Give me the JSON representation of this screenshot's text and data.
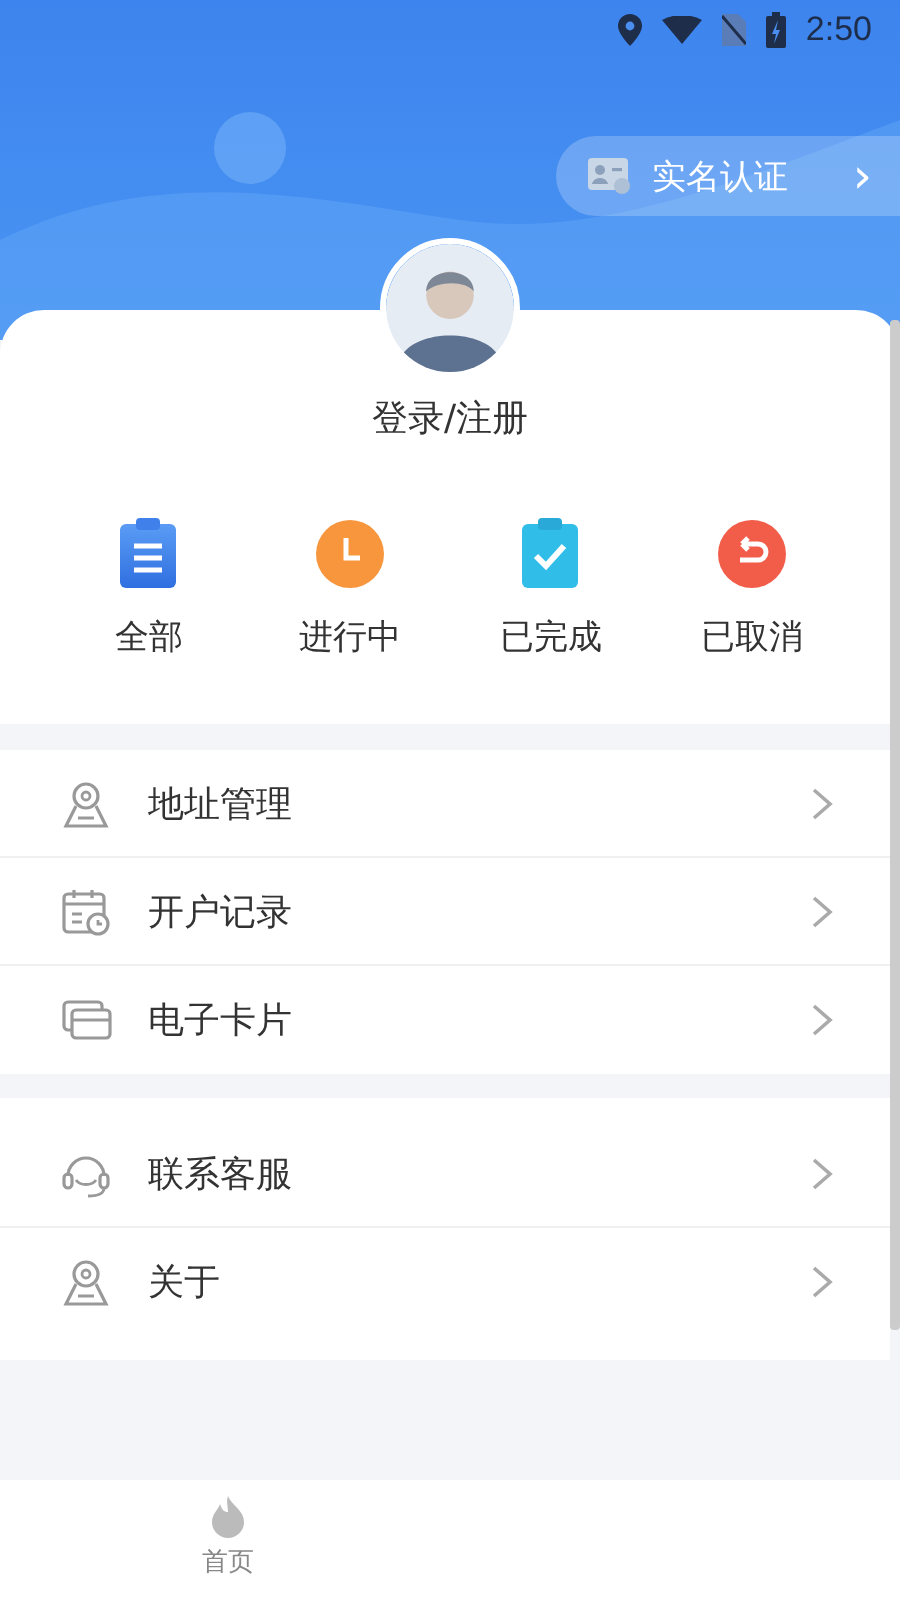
{
  "status_bar": {
    "time": "2:50"
  },
  "header": {
    "verify_button": {
      "label": "实名认证",
      "chevron": "›"
    }
  },
  "profile": {
    "login_label": "登录/注册"
  },
  "order_filters": [
    {
      "kind": "all",
      "label": "全部"
    },
    {
      "kind": "in_progress",
      "label": "进行中"
    },
    {
      "kind": "completed",
      "label": "已完成"
    },
    {
      "kind": "cancelled",
      "label": "已取消"
    }
  ],
  "menu_groups": [
    {
      "items": [
        {
          "kind": "address",
          "label": "地址管理"
        },
        {
          "kind": "records",
          "label": "开户记录"
        },
        {
          "kind": "card",
          "label": "电子卡片"
        }
      ]
    },
    {
      "items": [
        {
          "kind": "service",
          "label": "联系客服"
        },
        {
          "kind": "about",
          "label": "关于"
        }
      ]
    }
  ],
  "tab_bar": {
    "tabs": [
      {
        "label": "首页",
        "selected": false
      }
    ]
  }
}
